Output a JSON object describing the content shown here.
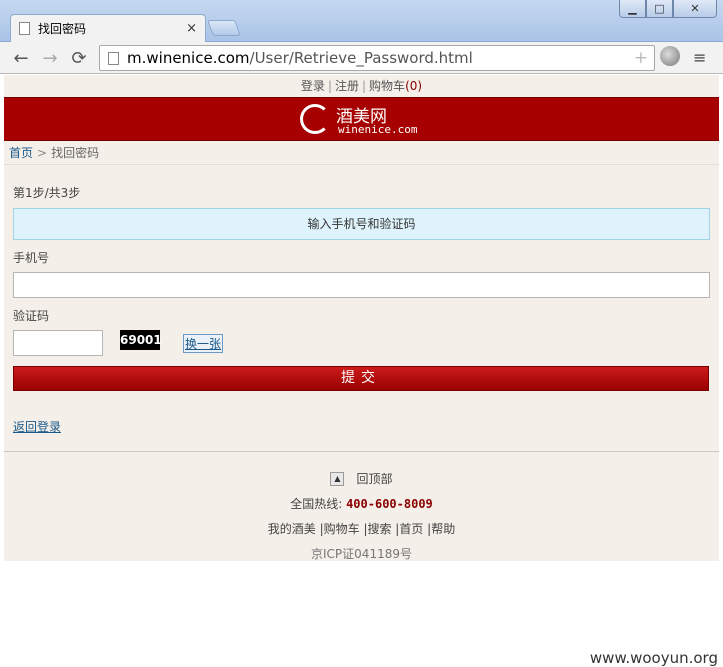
{
  "tab": {
    "title": "找回密码",
    "close": "×"
  },
  "window": {
    "minimize": "▁",
    "maximize": "□",
    "close": "✕"
  },
  "toolbar": {
    "back": "←",
    "forward": "→",
    "reload": "⟳",
    "url_host": "m.winenice.com",
    "url_path": "/User/Retrieve_Password.html",
    "star": "+",
    "menu": "≡"
  },
  "toplinks": {
    "login": "登录",
    "register": "注册",
    "cart": "购物车",
    "cart_count": "(0)",
    "sep": "|"
  },
  "logo": {
    "cn": "酒美网",
    "en": "winenice.com"
  },
  "breadcrumb": {
    "home": "首页",
    "arrow": ">",
    "current": "找回密码"
  },
  "form": {
    "step": "第1步/共3步",
    "step_title": "输入手机号和验证码",
    "phone_label": "手机号",
    "code_label": "验证码",
    "captcha": "69001",
    "change": "换一张",
    "submit": "提交",
    "back_login": "返回登录"
  },
  "footer": {
    "to_top": "回顶部",
    "to_top_icon": "▲",
    "hotline_label": "全国热线:",
    "hotline_number": "400-600-8009",
    "links": "我的酒美 |购物车 |搜索 |首页 |帮助",
    "icp": "京ICP证041189号"
  },
  "watermark": "www.wooyun.org",
  "colors": {
    "brand": "#a60000",
    "link": "#1a5a8a",
    "page_bg": "#f4efe9"
  }
}
